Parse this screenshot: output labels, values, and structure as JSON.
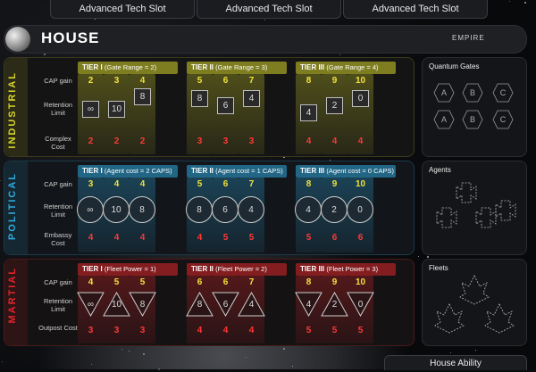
{
  "top_slots": [
    "Advanced Tech Slot",
    "Advanced Tech Slot",
    "Advanced Tech Slot"
  ],
  "house": {
    "title": "HOUSE",
    "subtitle": "EMPIRE"
  },
  "rows": [
    {
      "key": "industrial",
      "label": "INDUSTRIAL",
      "accent": "#d6d42a",
      "retention_shape": "square",
      "cap_label": "CAP gain",
      "retention_label": "Retention Limit",
      "cost_label": "Complex Cost",
      "tiers": [
        {
          "name": "TIER I",
          "sub": "(Gate Range = 2)"
        },
        {
          "name": "TIER II",
          "sub": "(Gate Range = 3)"
        },
        {
          "name": "TIER III",
          "sub": "(Gate Range = 4)"
        }
      ],
      "cap": [
        "2",
        "3",
        "4",
        "5",
        "6",
        "7",
        "8",
        "9",
        "10"
      ],
      "retention": [
        "∞",
        "10",
        "8",
        "8",
        "6",
        "4",
        "4",
        "2",
        "0"
      ],
      "cost": [
        "2",
        "2",
        "2",
        "3",
        "3",
        "3",
        "4",
        "4",
        "4"
      ]
    },
    {
      "key": "political",
      "label": "POLITICAL",
      "accent": "#2fa9e0",
      "retention_shape": "circle",
      "cap_label": "CAP gain",
      "retention_label": "Retention Limit",
      "cost_label": "Embassy Cost",
      "tiers": [
        {
          "name": "TIER I",
          "sub": "(Agent cost = 2 CAPS)"
        },
        {
          "name": "TIER II",
          "sub": "(Agent cost = 1 CAPS)"
        },
        {
          "name": "TIER III",
          "sub": "(Agent cost = 0 CAPS)"
        }
      ],
      "cap": [
        "3",
        "4",
        "4",
        "5",
        "6",
        "7",
        "8",
        "9",
        "10"
      ],
      "retention": [
        "∞",
        "10",
        "8",
        "8",
        "6",
        "4",
        "4",
        "2",
        "0"
      ],
      "cost": [
        "4",
        "4",
        "4",
        "4",
        "5",
        "5",
        "5",
        "6",
        "6"
      ]
    },
    {
      "key": "martial",
      "label": "MARTIAL",
      "accent": "#e0262b",
      "retention_shape": "triangle",
      "cap_label": "CAP gain",
      "retention_label": "Retention Limit",
      "cost_label": "Outpost Cost",
      "tiers": [
        {
          "name": "TIER I",
          "sub": "(Fleet Power = 1)"
        },
        {
          "name": "TIER II",
          "sub": "(Fleet Power = 2)"
        },
        {
          "name": "TIER III",
          "sub": "(Fleet Power = 3)"
        }
      ],
      "cap": [
        "4",
        "5",
        "5",
        "6",
        "6",
        "7",
        "8",
        "9",
        "10"
      ],
      "retention": [
        "∞",
        "10",
        "8",
        "8",
        "6",
        "4",
        "4",
        "2",
        "0"
      ],
      "cost": [
        "3",
        "3",
        "3",
        "4",
        "4",
        "4",
        "5",
        "5",
        "5"
      ]
    }
  ],
  "panels": {
    "gates_title": "Quantum Gates",
    "gates": [
      "A",
      "B",
      "C",
      "A",
      "B",
      "C"
    ],
    "agents_title": "Agents",
    "fleets_title": "Fleets"
  },
  "house_ability": "House Ability"
}
